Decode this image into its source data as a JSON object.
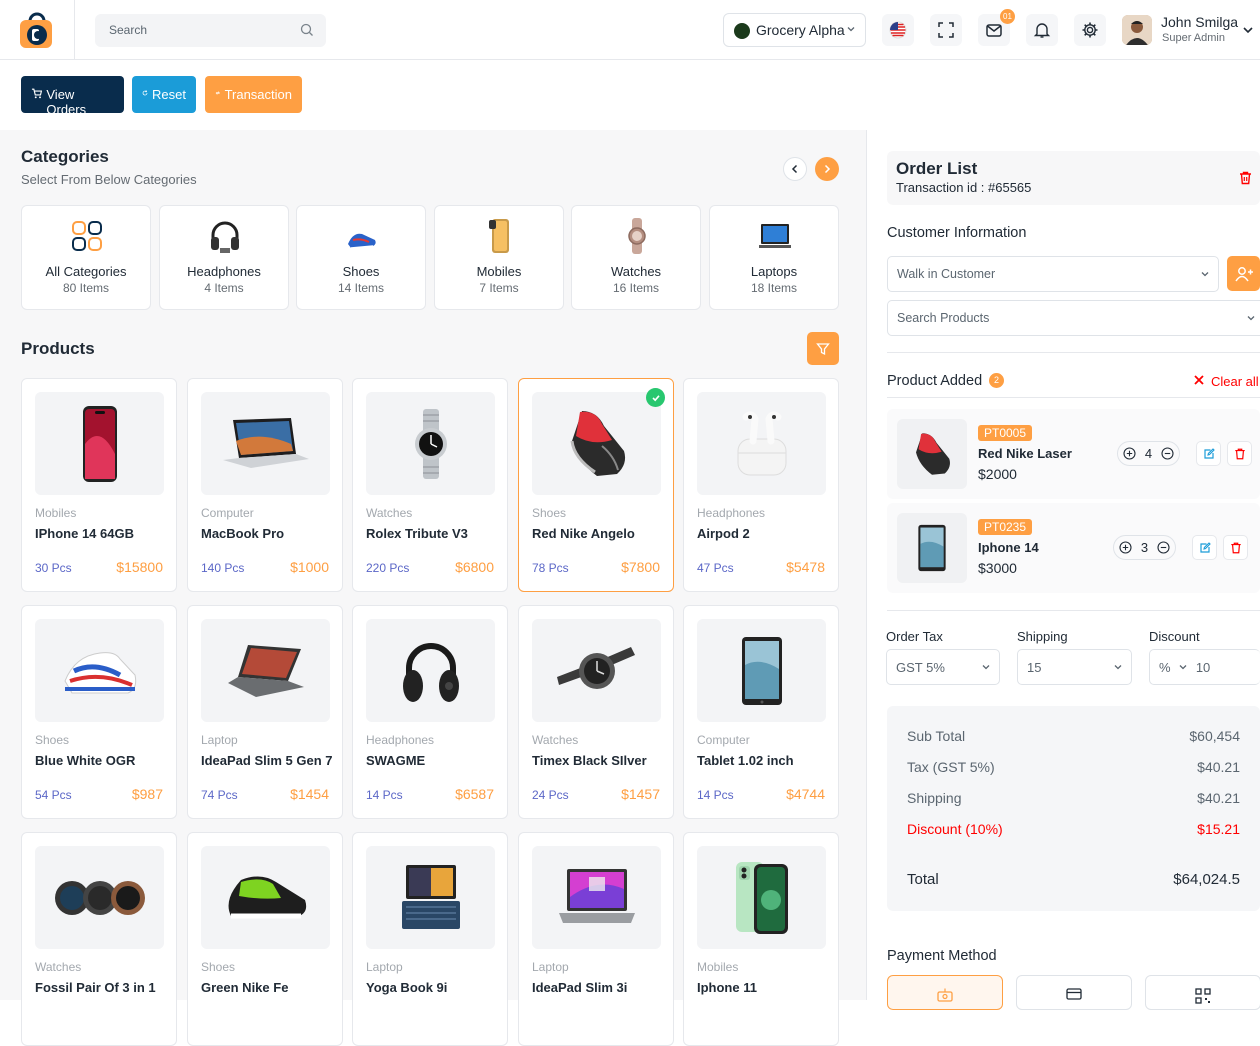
{
  "header": {
    "search_placeholder": "Search",
    "store_name": "Grocery Alpha",
    "mail_badge": "01",
    "user_name": "John Smilga",
    "user_role": "Super Admin"
  },
  "actions": {
    "view_orders": "View Orders",
    "reset": "Reset",
    "transaction": "Transaction"
  },
  "categories": {
    "title": "Categories",
    "subtitle": "Select From Below Categories",
    "items": [
      {
        "name": "All Categories",
        "count": "80 Items",
        "icon": "grid-icon"
      },
      {
        "name": "Headphones",
        "count": "4 Items",
        "icon": "headphones-icon"
      },
      {
        "name": "Shoes",
        "count": "14 Items",
        "icon": "shoe-icon"
      },
      {
        "name": "Mobiles",
        "count": "7 Items",
        "icon": "mobile-icon"
      },
      {
        "name": "Watches",
        "count": "16 Items",
        "icon": "watch-icon"
      },
      {
        "name": "Laptops",
        "count": "18 Items",
        "icon": "laptop-icon"
      }
    ]
  },
  "products": {
    "title": "Products",
    "items": [
      {
        "category": "Mobiles",
        "name": "IPhone 14 64GB",
        "qty": "30 Pcs",
        "price": "$15800",
        "icon": "phone-icon"
      },
      {
        "category": "Computer",
        "name": "MacBook Pro",
        "qty": "140 Pcs",
        "price": "$1000",
        "icon": "laptop-icon"
      },
      {
        "category": "Watches",
        "name": "Rolex Tribute V3",
        "qty": "220 Pcs",
        "price": "$6800",
        "icon": "watch-icon"
      },
      {
        "category": "Shoes",
        "name": "Red Nike Angelo",
        "qty": "78 Pcs",
        "price": "$7800",
        "icon": "shoe-icon",
        "selected": true
      },
      {
        "category": "Headphones",
        "name": "Airpod 2",
        "qty": "47 Pcs",
        "price": "$5478",
        "icon": "earbuds-icon"
      },
      {
        "category": "Shoes",
        "name": "Blue White OGR",
        "qty": "54 Pcs",
        "price": "$987",
        "icon": "shoe-icon"
      },
      {
        "category": "Laptop",
        "name": "IdeaPad Slim 5 Gen 7",
        "qty": "74 Pcs",
        "price": "$1454",
        "icon": "laptop-icon"
      },
      {
        "category": "Headphones",
        "name": "SWAGME",
        "qty": "14 Pcs",
        "price": "$6587",
        "icon": "headphones-icon"
      },
      {
        "category": "Watches",
        "name": "Timex Black SIlver",
        "qty": "24 Pcs",
        "price": "$1457",
        "icon": "watch-icon"
      },
      {
        "category": "Computer",
        "name": "Tablet 1.02 inch",
        "qty": "14 Pcs",
        "price": "$4744",
        "icon": "tablet-icon"
      },
      {
        "category": "Watches",
        "name": "Fossil Pair Of 3 in 1",
        "qty": "",
        "price": "",
        "icon": "watch-icon"
      },
      {
        "category": "Shoes",
        "name": "Green Nike Fe",
        "qty": "",
        "price": "",
        "icon": "shoe-icon"
      },
      {
        "category": "Laptop",
        "name": "Yoga Book 9i",
        "qty": "",
        "price": "",
        "icon": "laptop-icon"
      },
      {
        "category": "Laptop",
        "name": "IdeaPad Slim 3i",
        "qty": "",
        "price": "",
        "icon": "laptop-icon"
      },
      {
        "category": "Mobiles",
        "name": "Iphone 11",
        "qty": "",
        "price": "",
        "icon": "phone-icon"
      }
    ]
  },
  "order": {
    "title": "Order List",
    "transaction": "Transaction id : #65565",
    "customer_title": "Customer Information",
    "customer_value": "Walk in Customer",
    "search_products": "Search Products",
    "added_title": "Product Added",
    "added_count": "2",
    "clear_all": "Clear all",
    "items": [
      {
        "sku": "PT0005",
        "name": "Red Nike Laser",
        "price": "$2000",
        "qty": "4"
      },
      {
        "sku": "PT0235",
        "name": "Iphone 14",
        "price": "$3000",
        "qty": "3"
      }
    ],
    "tax_label": "Order Tax",
    "tax_value": "GST 5%",
    "shipping_label": "Shipping",
    "shipping_value": "15",
    "discount_label": "Discount",
    "discount_type": "%",
    "discount_value": "10",
    "summary": {
      "sub_total_label": "Sub Total",
      "sub_total": "$60,454",
      "tax_label": "Tax (GST 5%)",
      "tax": "$40.21",
      "shipping_label": "Shipping",
      "shipping": "$40.21",
      "discount_label": "Discount (10%)",
      "discount": "$15.21",
      "total_label": "Total",
      "total": "$64,024.5"
    },
    "payment_title": "Payment Method"
  },
  "colors": {
    "primary": "#092c4c",
    "info": "#1b9cd8",
    "accent": "#fe9f43",
    "danger": "#ff0000"
  }
}
